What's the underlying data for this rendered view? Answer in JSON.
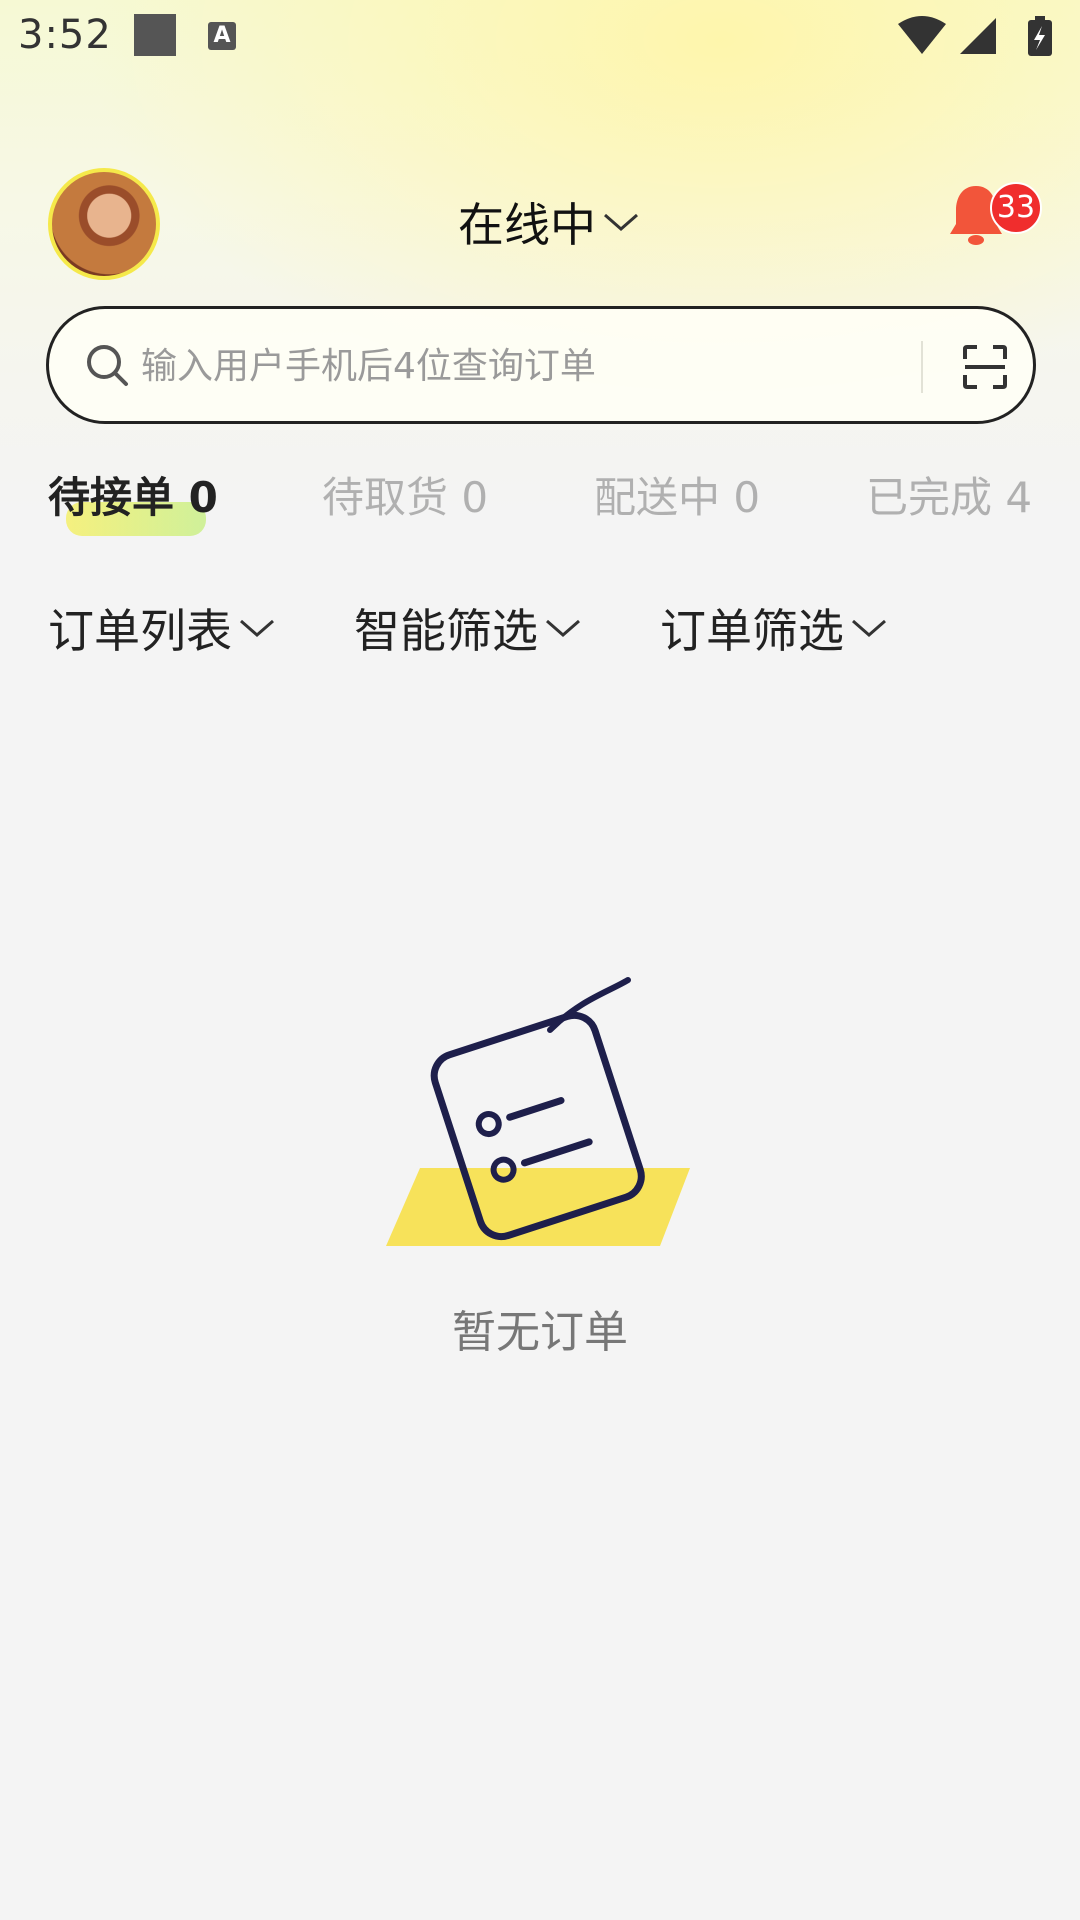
{
  "status_bar": {
    "time": "3:52",
    "notification_letter": "A"
  },
  "header": {
    "online_status": "在线中",
    "notification_count": "33"
  },
  "search": {
    "placeholder": "输入用户手机后4位查询订单"
  },
  "tabs": [
    {
      "label": "待接单 0",
      "active": true
    },
    {
      "label": "待取货 0",
      "active": false
    },
    {
      "label": "配送中 0",
      "active": false
    },
    {
      "label": "已完成 4",
      "active": false
    }
  ],
  "filters": [
    {
      "label": "订单列表"
    },
    {
      "label": "智能筛选"
    },
    {
      "label": "订单筛选"
    }
  ],
  "empty_state": {
    "message": "暂无订单"
  },
  "colors": {
    "accent_yellow": "#f7e25a",
    "badge_red": "#f02d2d",
    "illustration_navy": "#1e1f4b"
  }
}
